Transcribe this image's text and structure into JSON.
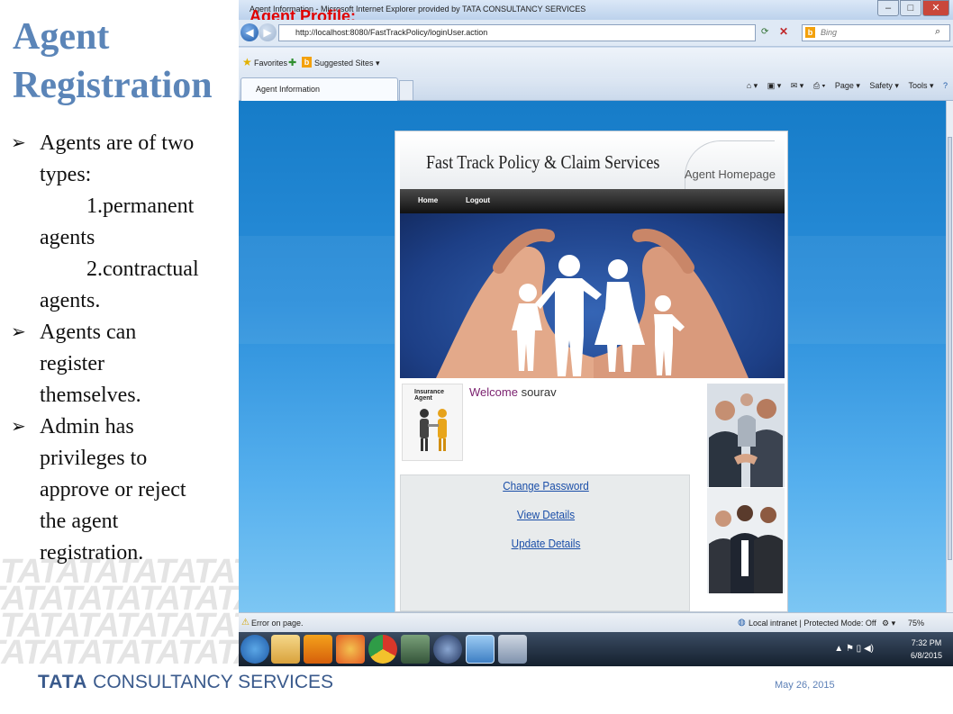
{
  "slide": {
    "title_line1": "Agent",
    "title_line2": "Registration",
    "bullet1_line1": "Agents are of two",
    "bullet1_line2": "types:",
    "sub1_line1": "1.permanent",
    "sub1_line2": "agents",
    "sub2_line1": "2.contractual",
    "sub2_line2": "agents.",
    "bullet2_line1": "Agents can",
    "bullet2_line2": "register",
    "bullet2_line3": "themselves.",
    "bullet3_line1": "Admin has",
    "bullet3_line2": "privileges to",
    "bullet3_line3": "approve or reject",
    "bullet3_line4": "the agent",
    "bullet3_line5": "registration.",
    "bullet_marker": "➢",
    "footer_company_bold": "TATA",
    "footer_company_rest": " CONSULTANCY SERVICES",
    "footer_date": "May 26, 2015",
    "pattern_text": "TATATATATATATA"
  },
  "browser": {
    "window_title": "Agent Information - Microsoft Internet Explorer provided by TATA CONSULTANCY SERVICES",
    "overlay_label": "Agent Profile:",
    "address_url": "http://localhost:8080/FastTrackPolicy/loginUser.action",
    "search_placeholder": "Bing",
    "favorites_label": "Favorites",
    "suggested_sites_label": "Suggested Sites ▾",
    "tab_label": "Agent Information",
    "cmd_page": "Page ▾",
    "cmd_safety": "Safety ▾",
    "cmd_tools": "Tools ▾",
    "status_text": "Error on page.",
    "zone_text": "Local intranet | Protected Mode: Off",
    "zoom_text": "75%",
    "clock_time": "7:32 PM",
    "clock_date": "6/8/2015"
  },
  "web_page": {
    "site_title": "Fast Track Policy & Claim Services",
    "page_subtitle": "Agent Homepage",
    "nav_home": "Home",
    "nav_logout": "Logout",
    "insurance_agent_label": "Insurance Agent",
    "welcome_word": "Welcome",
    "user_name": " sourav",
    "link_change_password": "Change Password",
    "link_view_details": "View Details",
    "link_update_details": "Update Details"
  },
  "colors": {
    "title_blue": "#5b85b8",
    "overlay_red": "#e00000",
    "welcome_purple": "#7a1f6e",
    "link_blue": "#1a4ea8",
    "footer_blue": "#3a5a8c"
  }
}
